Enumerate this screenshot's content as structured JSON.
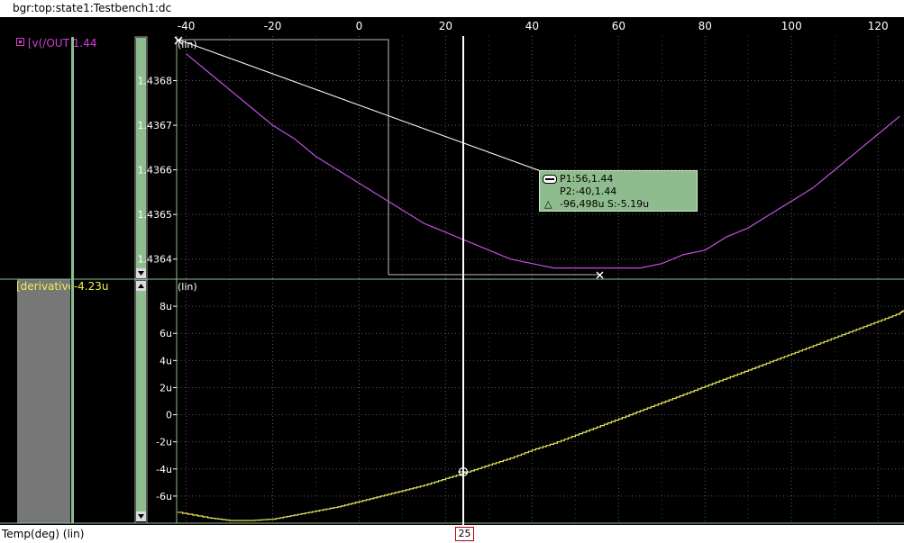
{
  "title": "bgr:top:state1:Testbench1:dc",
  "x_axis_label": "Temp(deg) (lin)",
  "cursor_value": "25",
  "legend": {
    "top_name": "[v(/OUT",
    "top_value": "1.44",
    "bottom_name": "[derivative",
    "bottom_value": "-4.23u"
  },
  "scale_label": "(lin)",
  "readout": {
    "p1": "P1:56,1.44",
    "p2": "P2:-40,1.44",
    "delta": "-96,498u S:-5.19u"
  },
  "colors": {
    "trace_top": "#c050e0",
    "trace_bottom": "#e8e85a",
    "trace_top_label": "#d040d0",
    "trace_bottom_label": "#f0f050",
    "scrollbar": "#8fbc8f",
    "panel_gray": "#777777"
  },
  "chart_data": [
    {
      "type": "line",
      "series": [
        {
          "name": "v(/OUT",
          "points": [
            [
              -40,
              1.43686
            ],
            [
              -35,
              1.43682
            ],
            [
              -30,
              1.43678
            ],
            [
              -25,
              1.43674
            ],
            [
              -20,
              1.4367
            ],
            [
              -15,
              1.43667
            ],
            [
              -10,
              1.43663
            ],
            [
              -5,
              1.4366
            ],
            [
              0,
              1.43657
            ],
            [
              5,
              1.43654
            ],
            [
              10,
              1.43651
            ],
            [
              15,
              1.43648
            ],
            [
              20,
              1.43646
            ],
            [
              25,
              1.43644
            ],
            [
              30,
              1.43642
            ],
            [
              35,
              1.4364
            ],
            [
              40,
              1.43639
            ],
            [
              45,
              1.43638
            ],
            [
              50,
              1.43638
            ],
            [
              56,
              1.43638
            ],
            [
              60,
              1.43638
            ],
            [
              65,
              1.43638
            ],
            [
              70,
              1.43639
            ],
            [
              75,
              1.43641
            ],
            [
              80,
              1.43642
            ],
            [
              85,
              1.43645
            ],
            [
              90,
              1.43647
            ],
            [
              95,
              1.4365
            ],
            [
              100,
              1.43653
            ],
            [
              105,
              1.43656
            ],
            [
              110,
              1.4366
            ],
            [
              115,
              1.43664
            ],
            [
              120,
              1.43668
            ],
            [
              125,
              1.43672
            ]
          ]
        }
      ],
      "xlim": [
        -42,
        126
      ],
      "ylim": [
        1.436355,
        1.4369
      ],
      "x_ticks": [
        "-40",
        "-20",
        "0",
        "20",
        "40",
        "60",
        "80",
        "100",
        "120"
      ],
      "y_ticks": [
        "1.4364",
        "1.4365",
        "1.4366",
        "1.4367",
        "1.4368"
      ],
      "y_tick_values": [
        1.4364,
        1.4365,
        1.4366,
        1.4367,
        1.4368
      ],
      "grid": true
    },
    {
      "type": "line",
      "series": [
        {
          "name": "derivative",
          "points": [
            [
              -42,
              -7.2
            ],
            [
              -35,
              -7.6
            ],
            [
              -30,
              -7.8
            ],
            [
              -25,
              -7.8
            ],
            [
              -20,
              -7.7
            ],
            [
              -15,
              -7.4
            ],
            [
              -10,
              -7.1
            ],
            [
              -5,
              -6.8
            ],
            [
              0,
              -6.4
            ],
            [
              5,
              -6.0
            ],
            [
              10,
              -5.6
            ],
            [
              15,
              -5.2
            ],
            [
              20,
              -4.7
            ],
            [
              25,
              -4.23
            ],
            [
              30,
              -3.7
            ],
            [
              35,
              -3.2
            ],
            [
              40,
              -2.6
            ],
            [
              45,
              -2.1
            ],
            [
              50,
              -1.5
            ],
            [
              55,
              -0.9
            ],
            [
              60,
              -0.3
            ],
            [
              65,
              0.3
            ],
            [
              70,
              0.9
            ],
            [
              75,
              1.5
            ],
            [
              80,
              2.1
            ],
            [
              85,
              2.7
            ],
            [
              90,
              3.3
            ],
            [
              95,
              3.9
            ],
            [
              100,
              4.5
            ],
            [
              105,
              5.1
            ],
            [
              110,
              5.7
            ],
            [
              115,
              6.3
            ],
            [
              120,
              6.9
            ],
            [
              125,
              7.5
            ],
            [
              126,
              7.7
            ]
          ]
        }
      ],
      "xlim": [
        -42,
        126
      ],
      "ylim": [
        -8,
        10
      ],
      "x_ticks": [
        "-40",
        "-20",
        "0",
        "20",
        "40",
        "60",
        "80",
        "100",
        "120"
      ],
      "y_ticks": [
        "8u",
        "6u",
        "4u",
        "2u",
        "0",
        "-2u",
        "-4u",
        "-6u"
      ],
      "y_tick_values": [
        8,
        6,
        4,
        2,
        0,
        -2,
        -4,
        -6
      ],
      "grid": true
    }
  ]
}
